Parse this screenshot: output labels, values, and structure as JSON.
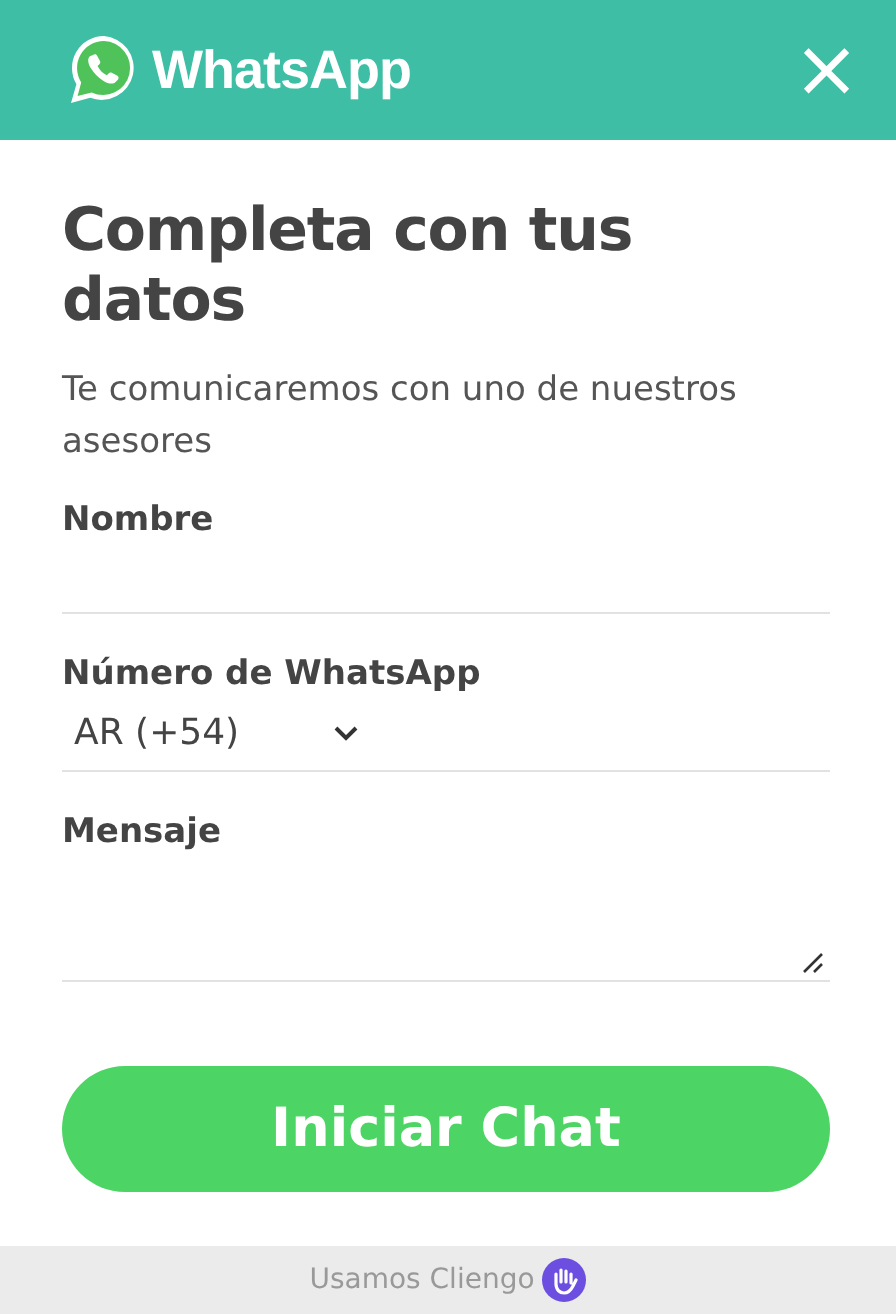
{
  "header": {
    "brand": "WhatsApp",
    "close": "×"
  },
  "title": "Completa con tus datos",
  "subtitle": "Te comunicaremos con uno de nuestros asesores",
  "fields": [
    {
      "kind": "text",
      "label": "Nombre"
    },
    {
      "kind": "select",
      "label": "Número de WhatsApp",
      "value": "AR (+54)"
    },
    {
      "kind": "textarea",
      "label": "Mensaje"
    }
  ],
  "submit": "Iniciar Chat",
  "footer": "Usamos Cliengo"
}
